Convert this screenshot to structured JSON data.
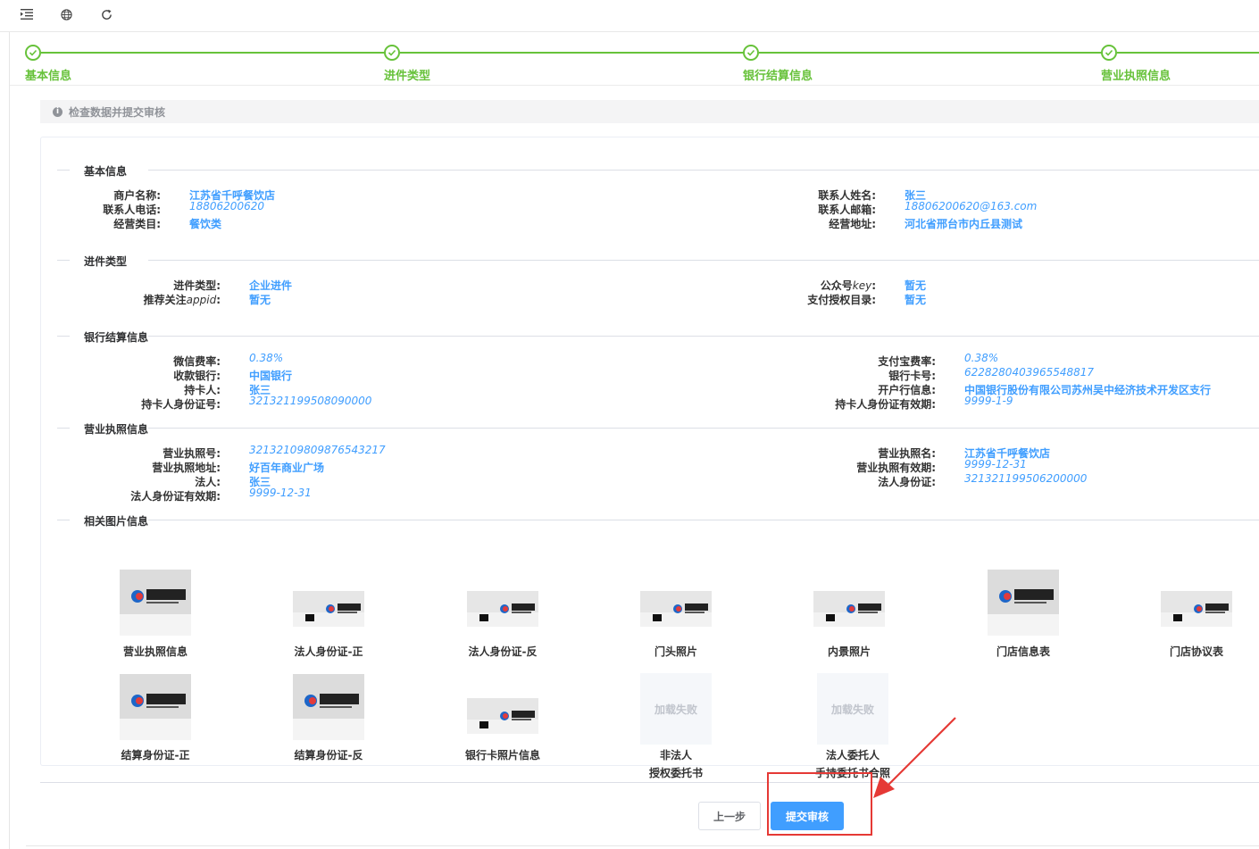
{
  "toolbar": {
    "icons": [
      "menu-fold-icon",
      "globe-icon",
      "refresh-icon"
    ]
  },
  "steps": [
    {
      "label": "基本信息"
    },
    {
      "label": "进件类型"
    },
    {
      "label": "银行结算信息"
    },
    {
      "label": "营业执照信息"
    }
  ],
  "notice": {
    "text": "检查数据并提交审核"
  },
  "sections": {
    "basic": {
      "title": "基本信息"
    },
    "type": {
      "title": "进件类型"
    },
    "bank": {
      "title": "银行结算信息"
    },
    "license": {
      "title": "营业执照信息"
    },
    "images": {
      "title": "相关图片信息"
    }
  },
  "basic": {
    "merchant_name_label": "商户名称:",
    "merchant_name": "江苏省千呼餐饮店",
    "contact_phone_label": "联系人电话:",
    "contact_phone": "18806200620",
    "category_label": "经营类目:",
    "category": "餐饮类",
    "contact_name_label": "联系人姓名:",
    "contact_name": "张三",
    "contact_email_label": "联系人邮箱:",
    "contact_email": "18806200620@163.com",
    "address_label": "经营地址:",
    "address": "河北省邢台市内丘县测试"
  },
  "type": {
    "apply_type_label": "进件类型:",
    "apply_type": "企业进件",
    "appid_label_a": "推荐关注",
    "appid_label_b": "appid",
    "appid_label_c": ":",
    "appid": "暂无",
    "key_label_a": "公众号",
    "key_label_b": "key",
    "key_label_c": ":",
    "key": "暂无",
    "pay_dir_label": "支付授权目录:",
    "pay_dir": "暂无"
  },
  "bank": {
    "wx_rate_label": "微信费率:",
    "wx_rate": "0.38%",
    "bank_label": "收款银行:",
    "bank": "中国银行",
    "holder_label": "持卡人:",
    "holder": "张三",
    "holder_id_label": "持卡人身份证号:",
    "holder_id": "321321199508090000",
    "ali_rate_label": "支付宝费率:",
    "ali_rate": "0.38%",
    "card_no_label": "银行卡号:",
    "card_no": "6228280403965548817",
    "branch_label": "开户行信息:",
    "branch": "中国银行股份有限公司苏州吴中经济技术开发区支行",
    "holder_id_exp_label": "持卡人身份证有效期:",
    "holder_id_exp": "9999-1-9"
  },
  "license": {
    "no_label": "营业执照号:",
    "no": "32132109809876543217",
    "addr_label": "营业执照地址:",
    "addr": "好百年商业广场",
    "legal_label": "法人:",
    "legal": "张三",
    "legal_id_exp_label": "法人身份证有效期:",
    "legal_id_exp": "9999-12-31",
    "name_label": "营业执照名:",
    "name": "江苏省千呼餐饮店",
    "exp_label": "营业执照有效期:",
    "exp": "9999-12-31",
    "legal_id_label": "法人身份证:",
    "legal_id": "321321199506200000"
  },
  "images": {
    "row1": [
      "营业执照信息",
      "法人身份证-正",
      "法人身份证-反",
      "门头照片",
      "内景照片",
      "门店信息表",
      "门店协议表"
    ],
    "row2": [
      "结算身份证-正",
      "结算身份证-反",
      "银行卡照片信息"
    ],
    "fail_text": "加载失败",
    "fail1_line1": "非法人",
    "fail1_line2": "授权委托书",
    "fail2_line1": "法人委托人",
    "fail2_line2": "手持委托书合照",
    "logo_text": "千呼软件"
  },
  "buttons": {
    "prev": "上一步",
    "submit": "提交审核"
  }
}
